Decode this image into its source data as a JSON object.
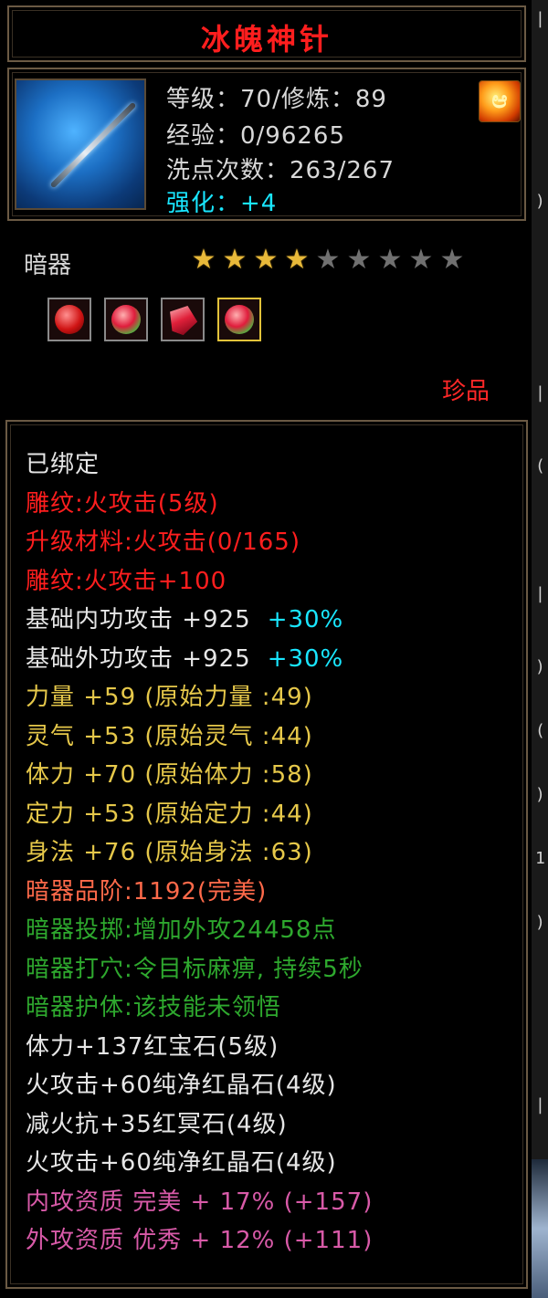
{
  "title": "冰魄神针",
  "item": {
    "level_line": "等级：70/修炼：89",
    "exp_line": "经验：0/96265",
    "reset_line": "洗点次数：263/267",
    "enhance_line": "强化：+4",
    "icon": "needle-icon",
    "fire_badge_icon": "fire-element-icon"
  },
  "category": "暗器",
  "stars": {
    "filled": 4,
    "total": 9
  },
  "gems": [
    {
      "icon": "red-round-gem-icon",
      "active": false
    },
    {
      "icon": "red-green-gem-icon",
      "active": false
    },
    {
      "icon": "red-crystal-gem-icon",
      "active": false
    },
    {
      "icon": "red-green-gem-icon",
      "active": true
    }
  ],
  "rarity": "珍品",
  "attributes": [
    {
      "text": "已绑定",
      "color": "white"
    },
    {
      "text": "雕纹:火攻击(5级)",
      "color": "red"
    },
    {
      "text": "升级材料:火攻击(0/165)",
      "color": "red"
    },
    {
      "text": "雕纹:火攻击+100",
      "color": "red"
    },
    {
      "text": "基础内功攻击 +925",
      "extra": "+30%",
      "color": "white"
    },
    {
      "text": "基础外功攻击 +925",
      "extra": "+30%",
      "color": "white"
    },
    {
      "text": "力量 +59 (原始力量 :49)",
      "color": "yellow"
    },
    {
      "text": "灵气 +53 (原始灵气 :44)",
      "color": "yellow"
    },
    {
      "text": "体力 +70 (原始体力 :58)",
      "color": "yellow"
    },
    {
      "text": "定力 +53 (原始定力 :44)",
      "color": "yellow"
    },
    {
      "text": "身法 +76 (原始身法 :63)",
      "color": "yellow"
    },
    {
      "text": "暗器品阶:1192(完美)",
      "color": "orange"
    },
    {
      "text": "暗器投掷:增加外攻24458点",
      "color": "green"
    },
    {
      "text": "暗器打穴:令目标麻痹, 持续5秒",
      "color": "green"
    },
    {
      "text": "暗器护体:该技能未领悟",
      "color": "green"
    },
    {
      "text": "体力+137红宝石(5级)",
      "color": "white"
    },
    {
      "text": "火攻击+60纯净红晶石(4级)",
      "color": "white"
    },
    {
      "text": "减火抗+35红冥石(4级)",
      "color": "white"
    },
    {
      "text": "火攻击+60纯净红晶石(4级)",
      "color": "white"
    },
    {
      "text": "内攻资质 完美 + 17% (+157)",
      "color": "pink"
    },
    {
      "text": "外攻资质 优秀 + 12% (+111)",
      "color": "pink"
    }
  ],
  "edge_glyphs": [
    "|",
    ")",
    "|",
    "(",
    "|",
    ")",
    "(",
    ")",
    "1",
    ")",
    "|"
  ],
  "colors": {
    "white": "#e6e6e6",
    "red": "#ff1e1e",
    "orange": "#ff6a4a",
    "yellow": "#e6c84a",
    "green": "#2ea82e",
    "pink": "#d85aa8",
    "cyan": "#19e6ff",
    "frame": "#6b5a44"
  }
}
